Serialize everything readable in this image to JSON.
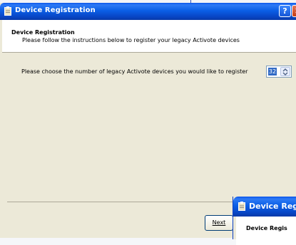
{
  "window": {
    "title": "Device Registration",
    "help_glyph": "?",
    "close_glyph": "✕"
  },
  "header": {
    "title": "Device Registration",
    "subtitle": "Please follow the instructions below to register your legacy Activote devices"
  },
  "main": {
    "prompt": "Please choose the number of legacy Activote devices you would like to register",
    "device_count": "32"
  },
  "footer": {
    "next_label": "Next"
  },
  "second_window": {
    "title": "Device Regi",
    "header_title": "Device Regis"
  },
  "icons": {
    "app": "clipboard-icon",
    "help": "help-icon",
    "close": "close-icon",
    "spin": "spin-arrows-icon"
  },
  "colors": {
    "titlebar": "#0b5fe6",
    "close_button": "#d4582f",
    "selection": "#316ac5",
    "dialog_face": "#ece9d8"
  }
}
